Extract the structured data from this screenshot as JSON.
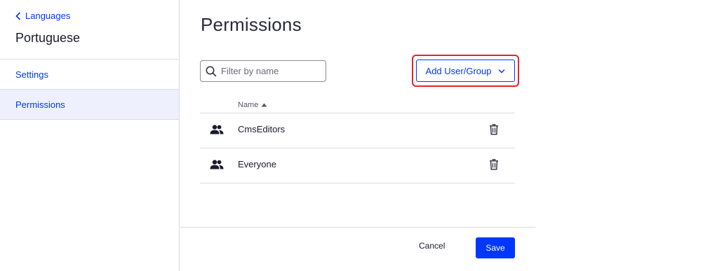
{
  "sidebar": {
    "back_label": "Languages",
    "title": "Portuguese",
    "items": [
      {
        "label": "Settings",
        "active": false
      },
      {
        "label": "Permissions",
        "active": true
      }
    ]
  },
  "main": {
    "title": "Permissions",
    "search": {
      "placeholder": "Filter by name",
      "value": ""
    },
    "add_button_label": "Add User/Group",
    "table": {
      "column_name": "Name",
      "sort": "ascending",
      "rows": [
        {
          "icon": "group-icon",
          "name": "CmsEditors"
        },
        {
          "icon": "group-icon",
          "name": "Everyone"
        }
      ]
    },
    "footer": {
      "cancel_label": "Cancel",
      "save_label": "Save"
    }
  },
  "colors": {
    "accent": "#0037ff",
    "highlight_border": "#e0252e",
    "active_nav_bg": "#eef0fd"
  }
}
